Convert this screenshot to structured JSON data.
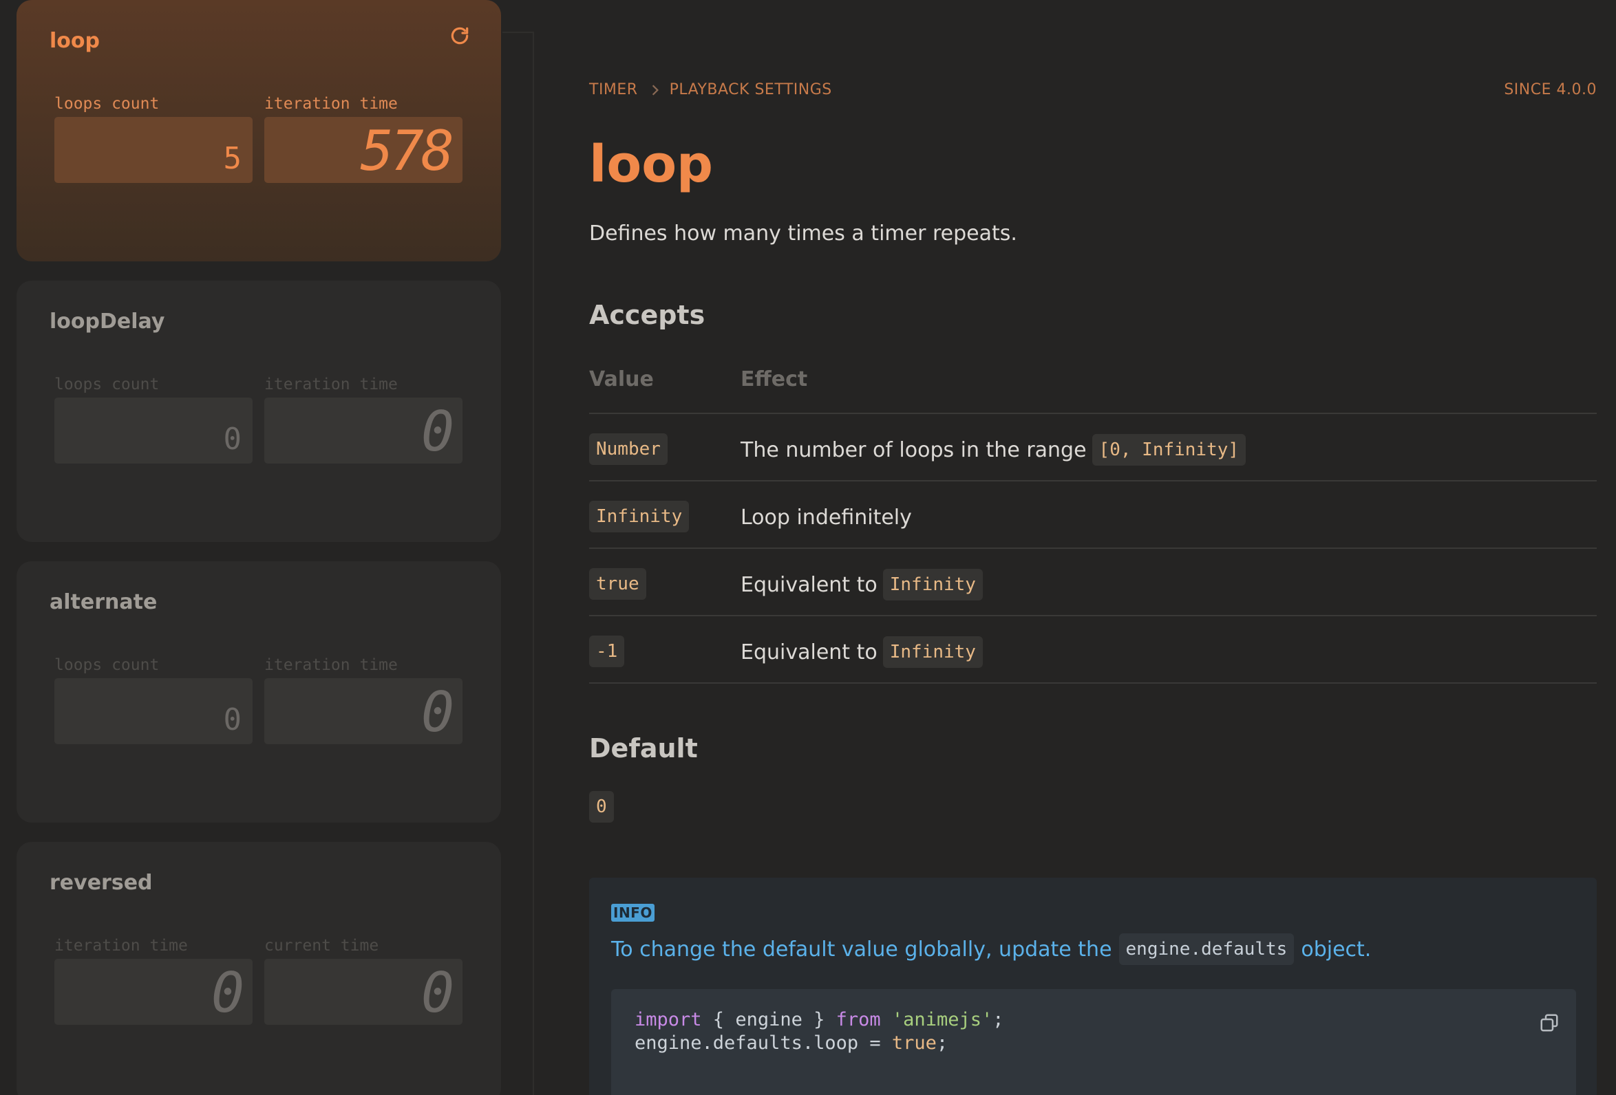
{
  "demos": [
    {
      "title": "loop",
      "active": true,
      "counters": [
        {
          "label": "loops count",
          "value": "5"
        },
        {
          "label": "iteration time",
          "value": "578"
        }
      ]
    },
    {
      "title": "loopDelay",
      "active": false,
      "counters": [
        {
          "label": "loops count",
          "value": "0"
        },
        {
          "label": "iteration time",
          "value": "0"
        }
      ]
    },
    {
      "title": "alternate",
      "active": false,
      "counters": [
        {
          "label": "loops count",
          "value": "0"
        },
        {
          "label": "iteration time",
          "value": "0"
        }
      ]
    },
    {
      "title": "reversed",
      "active": false,
      "counters": [
        {
          "label": "iteration time",
          "value": "0"
        },
        {
          "label": "current time",
          "value": "0"
        }
      ]
    }
  ],
  "breadcrumb": {
    "parent": "TIMER",
    "current": "PLAYBACK SETTINGS"
  },
  "since": "SINCE 4.0.0",
  "page_title": "loop",
  "lead": "Defines how many times a timer repeats.",
  "accepts": {
    "heading": "Accepts",
    "col_value": "Value",
    "col_effect": "Effect",
    "rows": [
      {
        "value": "Number",
        "effect": "The number of loops in the range",
        "effect_code": "[0, Infinity]"
      },
      {
        "value": "Infinity",
        "effect": "Loop indefinitely",
        "effect_code": ""
      },
      {
        "value": "true",
        "effect": "Equivalent to",
        "effect_code": "Infinity"
      },
      {
        "value": "-1",
        "effect": "Equivalent to",
        "effect_code": "Infinity"
      }
    ]
  },
  "default": {
    "heading": "Default",
    "value": "0"
  },
  "info": {
    "badge": "INFO",
    "text_before": "To change the default value globally, update the",
    "code": "engine.defaults",
    "text_after": "object.",
    "code_block": {
      "line1": {
        "kw1": "import",
        "mid": " { engine } ",
        "kw2": "from",
        "sp": " ",
        "str": "'animejs'",
        "end": ";"
      },
      "line2": {
        "pre": "engine.defaults.loop = ",
        "bool": "true",
        "end": ";"
      }
    }
  },
  "colors": {
    "accent": "#f0894a",
    "info": "#5bb2ea",
    "code": "#e8b986"
  }
}
